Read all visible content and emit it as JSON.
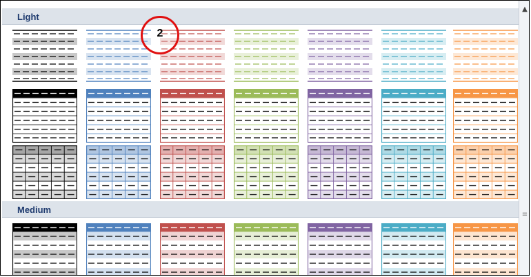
{
  "gallery": {
    "sections": {
      "light": {
        "label": "Light"
      },
      "medium": {
        "label": "Medium"
      }
    },
    "colors": [
      "#000000",
      "#4f81bd",
      "#c0504d",
      "#9bbb59",
      "#8064a2",
      "#4bacc6",
      "#f79646"
    ],
    "color_names": [
      "black",
      "blue",
      "red",
      "green",
      "purple",
      "aqua",
      "orange"
    ],
    "row_styles": [
      "light-banded",
      "light-header-grid",
      "light-all-borders",
      "medium-banded"
    ]
  },
  "annotation": {
    "callout_label": "2"
  },
  "scrollbar": {
    "up_icon": "up-arrow-icon",
    "grip_icon": "grip-icon"
  }
}
